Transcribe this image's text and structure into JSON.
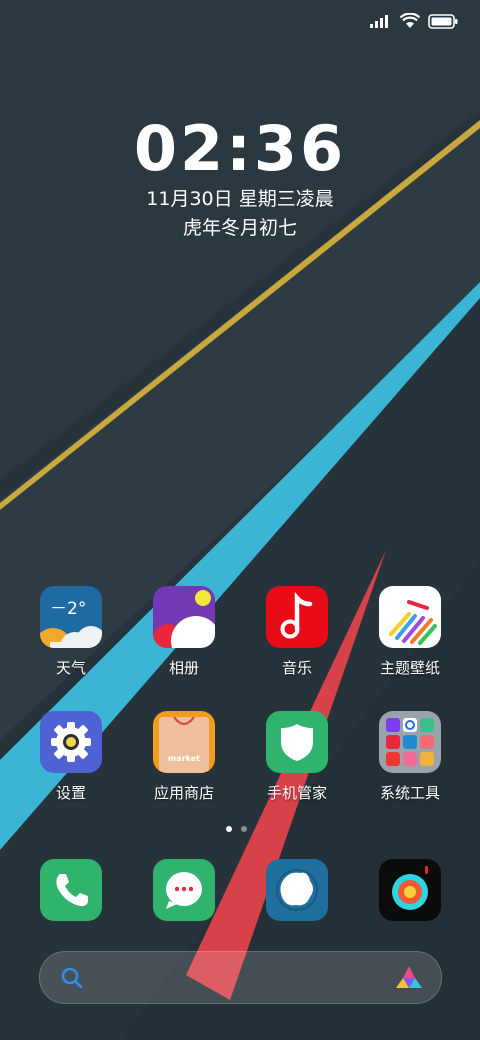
{
  "status_bar": {
    "icons": [
      "signal-icon",
      "wifi-icon",
      "battery-icon"
    ]
  },
  "lock": {
    "time": "02:36",
    "date": "11月30日 星期三凌晨",
    "lunar": "虎年冬月初七"
  },
  "weather_widget": {
    "temperature": "－2°"
  },
  "apps": [
    {
      "label": "天气",
      "icon": "weather-icon"
    },
    {
      "label": "相册",
      "icon": "gallery-icon"
    },
    {
      "label": "音乐",
      "icon": "music-icon"
    },
    {
      "label": "主题壁纸",
      "icon": "themes-icon"
    },
    {
      "label": "设置",
      "icon": "settings-icon"
    },
    {
      "label": "应用商店",
      "icon": "app-store-icon",
      "badge_text": "market"
    },
    {
      "label": "手机管家",
      "icon": "security-icon"
    },
    {
      "label": "系统工具",
      "icon": "tools-folder-icon"
    }
  ],
  "page_indicator": {
    "pages": 2,
    "active": 1
  },
  "dock": [
    {
      "icon": "phone-icon"
    },
    {
      "icon": "messages-icon"
    },
    {
      "icon": "browser-icon"
    },
    {
      "icon": "camera-icon"
    }
  ],
  "colors": {
    "background": "#27333a",
    "gold_stripe": "#c9a83f",
    "cyan_stripe": "#3cb4d6",
    "red_stripe": "#d7414a"
  }
}
